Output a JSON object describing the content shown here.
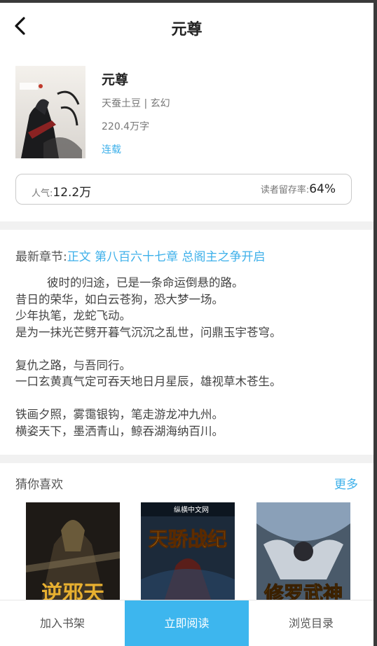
{
  "header": {
    "title": "元尊"
  },
  "book": {
    "name": "元尊",
    "author_genre": "天蚕土豆 | 玄幻",
    "words": "220.4万字",
    "status": "连载",
    "cover_text": "元尊"
  },
  "stats": {
    "popularity_label": "人气:",
    "popularity_value": "12.2万",
    "retention_label": "读者留存率:",
    "retention_value": "64%"
  },
  "latest": {
    "label": "最新章节:",
    "chapter": "正文 第八百六十七章 总阁主之争开启"
  },
  "intro": {
    "line1": "彼时的归途，已是一条命运倒悬的路。",
    "line2": "昔日的荣华，如白云苍狗，恐大梦一场。",
    "line3": "少年执笔，龙蛇飞动。",
    "line4": "是为一抹光芒劈开暮气沉沉之乱世，问鼎玉宇苍穹。",
    "line5": "复仇之路，与吾同行。",
    "line6": "一口玄黄真气定可吞天地日月星辰，雄视草木苍生。",
    "line7": "铁画夕照，雾霭银钩，笔走游龙冲九州。",
    "line8": "横姿天下，墨洒青山，鲸吞湖海纳百川。"
  },
  "recommend": {
    "title": "猜你喜欢",
    "more": "更多",
    "books": [
      {
        "cover_text": "逆邪天"
      },
      {
        "cover_text": "天骄战纪",
        "badge": "纵横中文网"
      },
      {
        "cover_text": "修罗武神"
      }
    ]
  },
  "bottom_bar": {
    "add_shelf": "加入书架",
    "read_now": "立即阅读",
    "catalog": "浏览目录"
  },
  "colors": {
    "accent": "#3db6ee",
    "link": "#3db0ea",
    "divider": "#f1f1f1"
  }
}
